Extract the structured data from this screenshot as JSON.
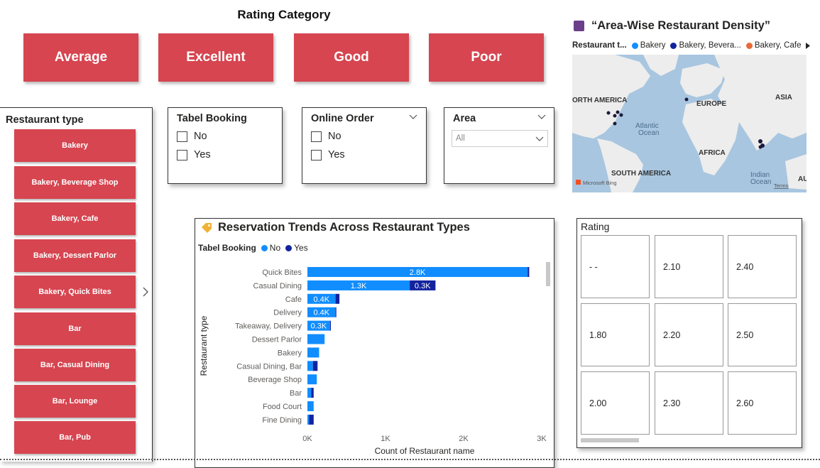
{
  "rating_category": {
    "title": "Rating Category",
    "buttons": [
      "Average",
      "Excellent",
      "Good",
      "Poor"
    ]
  },
  "restaurant_type_slicer": {
    "title": "Restaurant type",
    "items": [
      "Bakery",
      "Bakery, Beverage Shop",
      "Bakery, Cafe",
      "Bakery, Dessert Parlor",
      "Bakery, Quick Bites",
      "Bar",
      "Bar, Casual Dining",
      "Bar, Lounge",
      "Bar, Pub"
    ],
    "next_icon": "chevron-right-icon"
  },
  "table_booking_slicer": {
    "title": "Tabel Booking",
    "options": [
      "No",
      "Yes"
    ]
  },
  "online_order_slicer": {
    "title": "Online Order",
    "options": [
      "No",
      "Yes"
    ],
    "icon": "chevron-down-icon"
  },
  "area_slicer": {
    "title": "Area",
    "selected": "All",
    "icon": "chevron-down-icon"
  },
  "map": {
    "title": "“Area-Wise Restaurant Density”",
    "legend_title": "Restaurant t...",
    "legend_items": [
      {
        "label": "Bakery",
        "color": "#118dff"
      },
      {
        "label": "Bakery, Bevera...",
        "color": "#12239e"
      },
      {
        "label": "Bakery, Cafe",
        "color": "#e66c37"
      }
    ],
    "labels": [
      "ORTH AMERICA",
      "EUROPE",
      "ASIA",
      "Atlantic",
      "Ocean",
      "AFRICA",
      "SOUTH AMERICA",
      "Indian",
      "Ocean",
      "AU"
    ],
    "attribution": "Microsoft Bing",
    "terms": "Terms"
  },
  "reservation_chart": {
    "title": "Reservation Trends Across Restaurant Types",
    "legend_title": "Tabel Booking",
    "colors": {
      "No": "#118dff",
      "Yes": "#12239e"
    }
  },
  "chart_data": {
    "type": "bar",
    "orientation": "horizontal",
    "stacked": true,
    "title": "Reservation Trends Across Restaurant Types",
    "xlabel": "Count of Restaurant name",
    "ylabel": "Restaurant type",
    "xlim": [
      0,
      3000
    ],
    "xticks": [
      "0K",
      "1K",
      "2K",
      "3K"
    ],
    "categories": [
      "Quick Bites",
      "Casual Dining",
      "Cafe",
      "Delivery",
      "Takeaway, Delivery",
      "Dessert Parlor",
      "Bakery",
      "Casual Dining, Bar",
      "Beverage Shop",
      "Bar",
      "Food Court",
      "Fine Dining"
    ],
    "series": [
      {
        "name": "No",
        "values": [
          2820,
          1310,
          360,
          360,
          290,
          220,
          150,
          70,
          120,
          50,
          80,
          20
        ]
      },
      {
        "name": "Yes",
        "values": [
          20,
          330,
          50,
          10,
          10,
          0,
          0,
          60,
          0,
          30,
          0,
          60
        ]
      }
    ],
    "data_labels": [
      {
        "category": "Quick Bites",
        "series": "No",
        "text": "2.8K"
      },
      {
        "category": "Casual Dining",
        "series": "No",
        "text": "1.3K"
      },
      {
        "category": "Casual Dining",
        "series": "Yes",
        "text": "0.3K"
      },
      {
        "category": "Cafe",
        "series": "No",
        "text": "0.4K"
      },
      {
        "category": "Delivery",
        "series": "No",
        "text": "0.4K"
      },
      {
        "category": "Takeaway, Delivery",
        "series": "No",
        "text": "0.3K"
      }
    ]
  },
  "rating_table": {
    "title": "Rating",
    "cells": [
      "- -",
      "2.10",
      "2.40",
      "1.80",
      "2.20",
      "2.50",
      "2.00",
      "2.30",
      "2.60"
    ]
  }
}
